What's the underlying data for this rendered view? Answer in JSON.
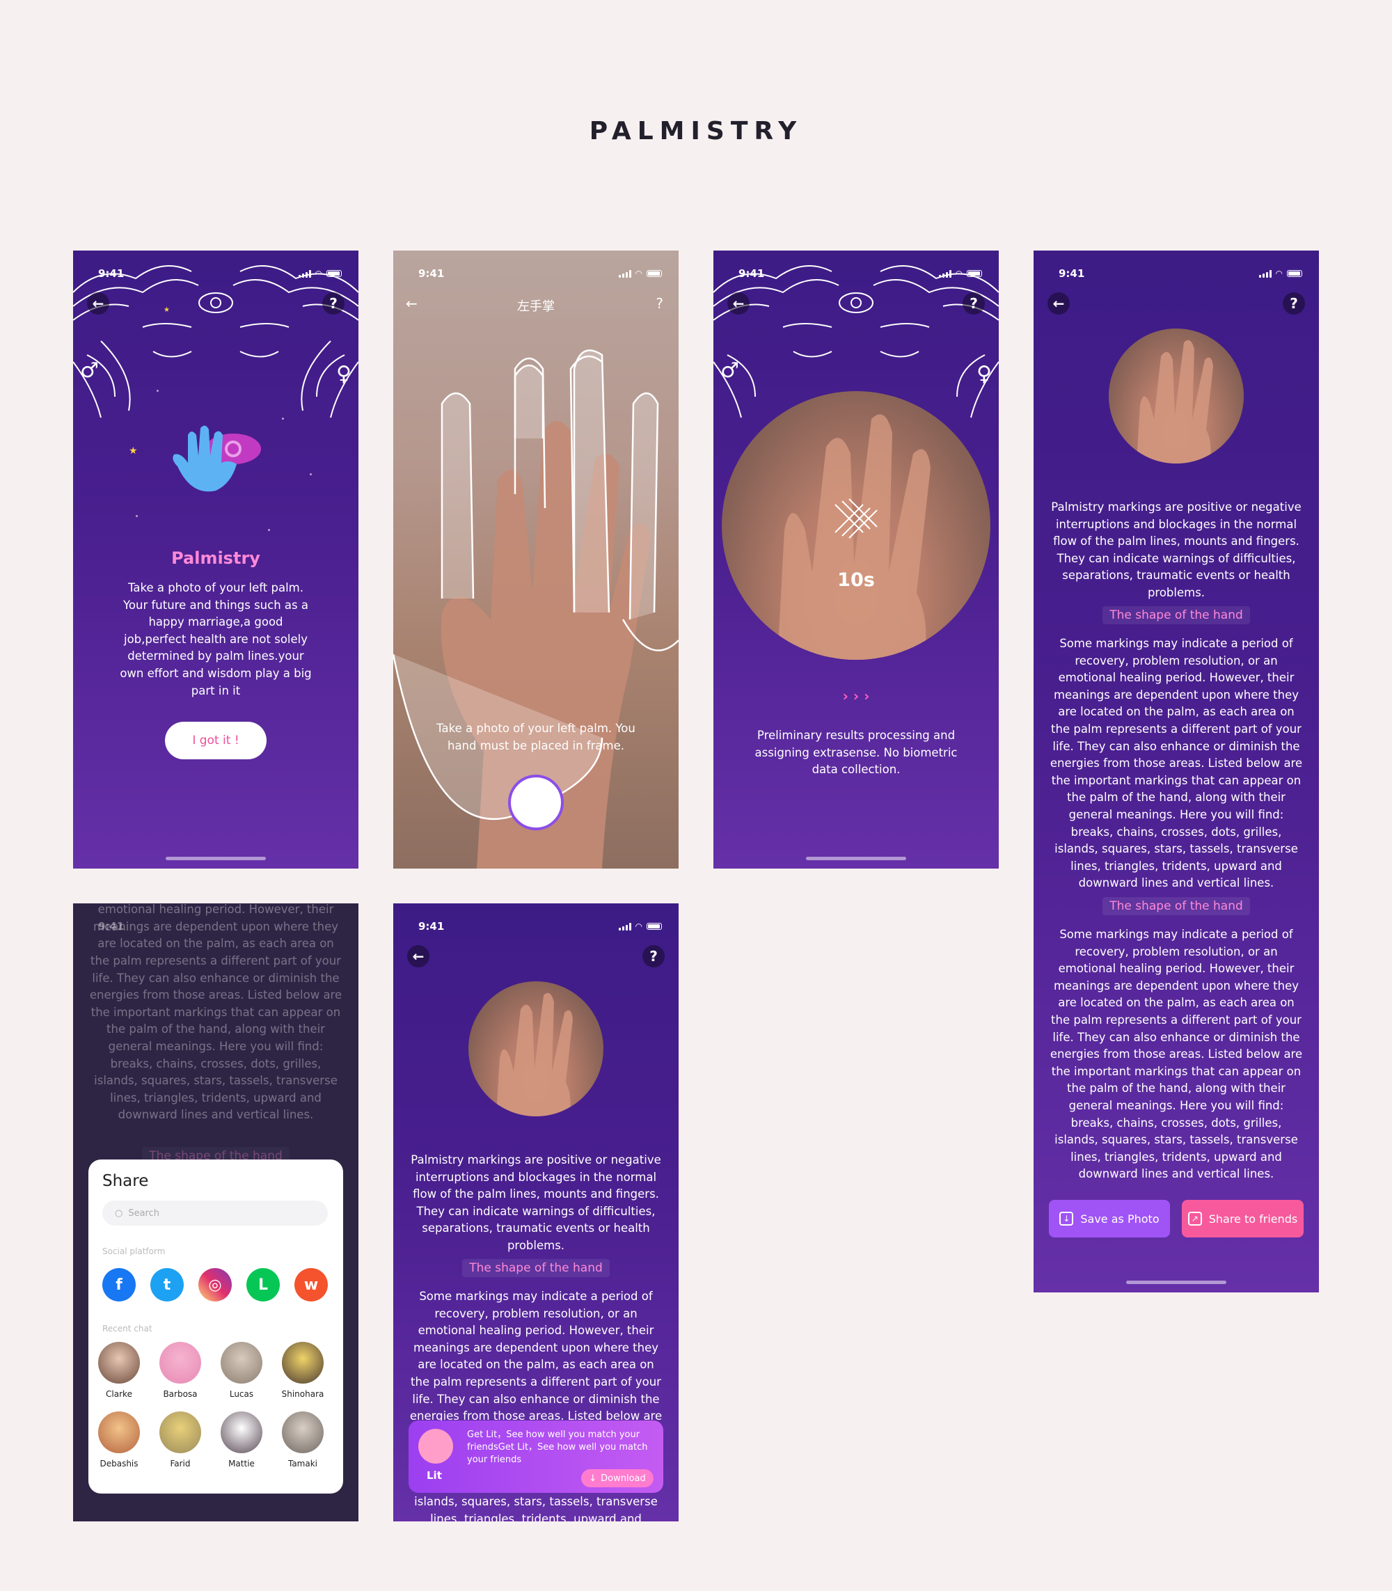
{
  "page": {
    "title": "PALMISTRY"
  },
  "status": {
    "time": "9:41"
  },
  "nav": {
    "back_glyph": "←",
    "help_glyph": "?"
  },
  "symbols": {
    "male": "♂",
    "female": "♀"
  },
  "intro": {
    "title": "Palmistry",
    "body": "Take a photo of your left palm. Your future and things such as a happy marriage,a good job,perfect health are not solely determined by palm lines.your own effort and wisdom play a big part in it",
    "cta": "I got it !"
  },
  "camera": {
    "title": "左手掌",
    "hint": "Take a photo of your left palm. You hand must be placed in frame."
  },
  "processing": {
    "countdown": "10s",
    "chevrons": "› › ›",
    "message": "Preliminary results processing and assigning extrasense. No biometric data collection."
  },
  "result": {
    "intro": "Palmistry markings are positive or negative interruptions and blockages in the normal flow of the palm lines, mounts and fingers. They can indicate warnings of difficulties, separations, traumatic events or health problems.",
    "section_title": "The shape of the hand",
    "section_body": "Some markings may indicate a period of recovery, problem resolution, or an emotional healing period. However, their meanings are dependent upon where they are located on the palm, as each area on the palm represents a different part of your life. They can also enhance or diminish the energies from those areas. Listed below are the important markings that can appear on the palm of the hand, along with their general meanings. Here you will find: breaks, chains, crosses, dots, grilles, islands, squares, stars, tassels, transverse lines, triangles, tridents, upward and downward lines and vertical lines.",
    "save_label": "Save as Photo",
    "share_label": "Share to friends"
  },
  "share": {
    "title": "Share",
    "search_placeholder": "Search",
    "social_label": "Social platform",
    "recent_label": "Recent chat",
    "platforms": [
      {
        "name": "facebook",
        "glyph": "f",
        "color": "#1877f2"
      },
      {
        "name": "twitter",
        "glyph": "t",
        "color": "#1da1f2"
      },
      {
        "name": "instagram",
        "glyph": "◎",
        "color": "#e1306c"
      },
      {
        "name": "line",
        "glyph": "L",
        "color": "#06c755"
      },
      {
        "name": "weibo",
        "glyph": "w",
        "color": "#f5532d"
      }
    ],
    "contacts": [
      "Clarke",
      "Barbosa",
      "Lucas",
      "Shinohara",
      "Debashis",
      "Farid",
      "Mattie",
      "Tamaki"
    ]
  },
  "banner": {
    "brand": "Lit",
    "text": "Get Lit，See how well you match your friendsGet Lit，See how well you match your friends",
    "download": "Download"
  }
}
